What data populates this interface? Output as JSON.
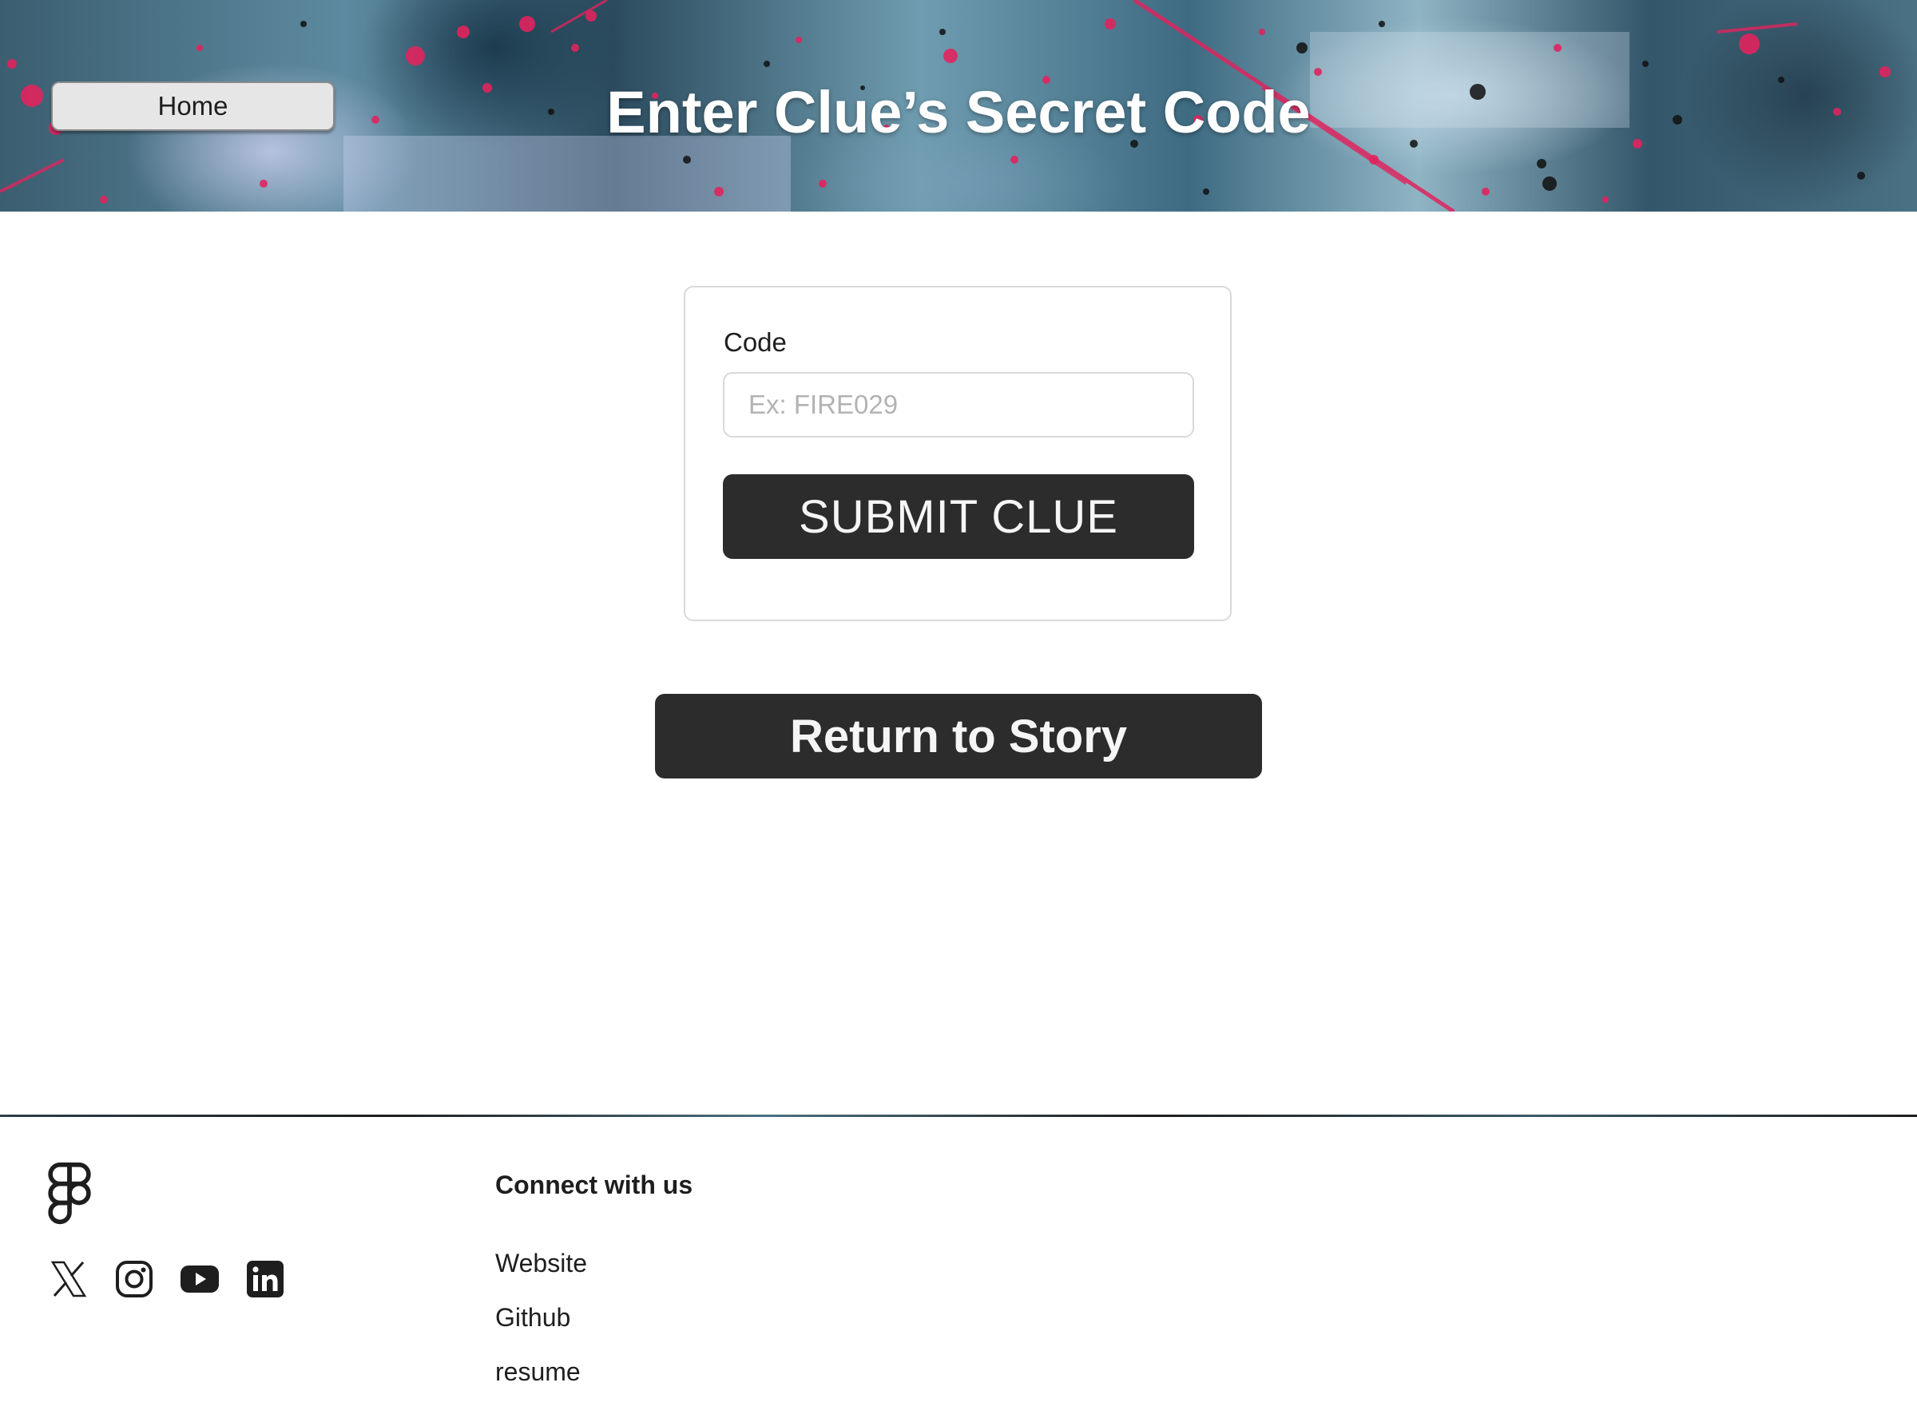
{
  "header": {
    "home_label": "Home",
    "title": "Enter Clue’s Secret Code"
  },
  "form": {
    "code_label": "Code",
    "code_placeholder": "Ex: FIRE029",
    "code_value": "",
    "submit_label": "SUBMIT CLUE"
  },
  "return_label": "Return to Story",
  "footer": {
    "logo": "figma-logo",
    "social_icons": [
      "x-icon",
      "instagram-icon",
      "youtube-icon",
      "linkedin-icon"
    ],
    "connect_heading": "Connect with us",
    "links": [
      "Website",
      "Github",
      "resume"
    ]
  },
  "colors": {
    "button_dark": "#2c2c2c",
    "button_text": "#f5f5f5",
    "home_button_bg": "#e6e6e6",
    "border": "#d9d9d9",
    "placeholder": "#b3b3b3",
    "accent_splatter": "#e0245e"
  }
}
